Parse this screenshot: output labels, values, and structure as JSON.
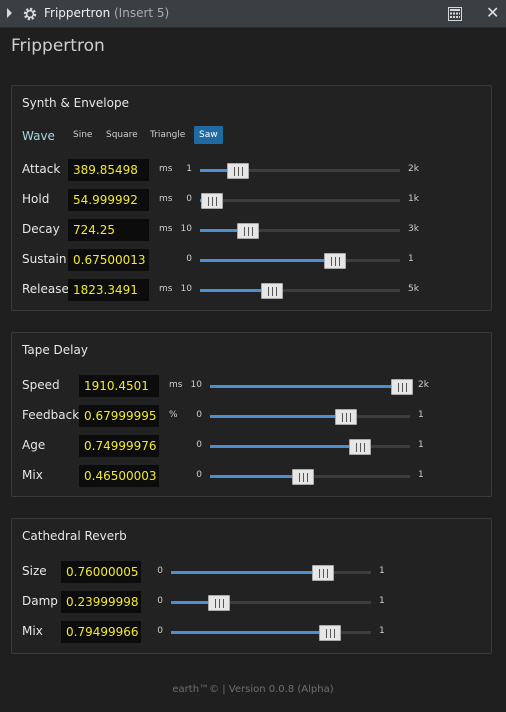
{
  "titlebar": {
    "title": "Frippertron",
    "subtitle": "(Insert 5)"
  },
  "plugin_title": "Frippertron",
  "synth": {
    "title": "Synth & Envelope",
    "wave_label": "Wave",
    "wave_options": [
      "Sine",
      "Square",
      "Triangle",
      "Saw"
    ],
    "wave_selected": "Saw",
    "params": [
      {
        "label": "Attack",
        "value": "389.85498",
        "unit": "ms",
        "min": "1",
        "max": "2k",
        "level": 0.19
      },
      {
        "label": "Hold",
        "value": "54.999992",
        "unit": "ms",
        "min": "0",
        "max": "1k",
        "level": 0.06
      },
      {
        "label": "Decay",
        "value": "724.25",
        "unit": "ms",
        "min": "10",
        "max": "3k",
        "level": 0.24
      },
      {
        "label": "Sustain",
        "value": "0.67500013",
        "unit": "",
        "min": "0",
        "max": "1",
        "level": 0.675
      },
      {
        "label": "Release",
        "value": "1823.3491",
        "unit": "ms",
        "min": "10",
        "max": "5k",
        "level": 0.36
      }
    ]
  },
  "delay": {
    "title": "Tape Delay",
    "params": [
      {
        "label": "Speed",
        "value": "1910.4501",
        "unit": "ms",
        "min": "10",
        "max": "2k",
        "level": 0.96
      },
      {
        "label": "Feedback",
        "value": "0.67999995",
        "unit": "%",
        "min": "0",
        "max": "1",
        "level": 0.68
      },
      {
        "label": "Age",
        "value": "0.74999976",
        "unit": "",
        "min": "0",
        "max": "1",
        "level": 0.75
      },
      {
        "label": "Mix",
        "value": "0.46500003",
        "unit": "",
        "min": "0",
        "max": "1",
        "level": 0.465
      }
    ]
  },
  "reverb": {
    "title": "Cathedral Reverb",
    "params": [
      {
        "label": "Size",
        "value": "0.76000005",
        "unit": "",
        "min": "0",
        "max": "1",
        "level": 0.76
      },
      {
        "label": "Damp",
        "value": "0.23999998",
        "unit": "",
        "min": "0",
        "max": "1",
        "level": 0.24
      },
      {
        "label": "Mix",
        "value": "0.79499966",
        "unit": "",
        "min": "0",
        "max": "1",
        "level": 0.795
      }
    ]
  },
  "footer": "earth™© | Version 0.0.8 (Alpha)",
  "colors": {
    "accent": "#4a90d0",
    "value_text": "#f2ea2a",
    "selected_wave": "#1f6aa0"
  }
}
